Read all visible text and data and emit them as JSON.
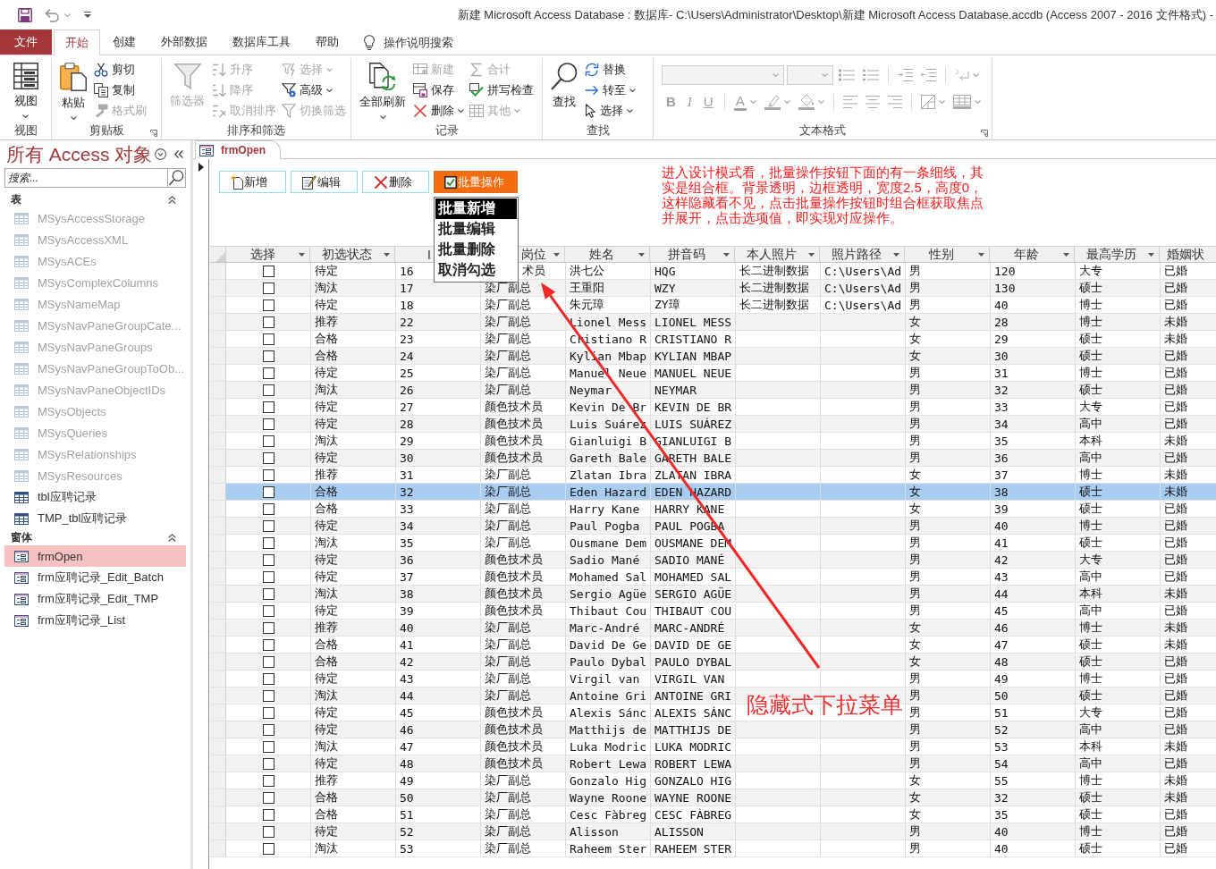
{
  "title_bar": {
    "title": "新建 Microsoft Access Database : 数据库- C:\\Users\\Administrator\\Desktop\\新建 Microsoft Access Database.accdb (Access 2007 - 2016 文件格式)  -"
  },
  "tabs": [
    {
      "label": "文件",
      "kind": "file",
      "selected": false
    },
    {
      "label": "开始",
      "kind": "tab",
      "selected": true
    },
    {
      "label": "创建",
      "kind": "tab",
      "selected": false
    },
    {
      "label": "外部数据",
      "kind": "tab",
      "selected": false
    },
    {
      "label": "数据库工具",
      "kind": "tab",
      "selected": false
    },
    {
      "label": "帮助",
      "kind": "tab",
      "selected": false
    }
  ],
  "tell_me": {
    "placeholder": "操作说明搜索"
  },
  "ribbon": {
    "groups": [
      {
        "label": "视图",
        "launcher": false,
        "items": [
          {
            "label": "视图",
            "kind": "large",
            "dropdown": true,
            "disabled": false
          }
        ]
      },
      {
        "label": "剪贴板",
        "launcher": true,
        "items": [
          {
            "label": "粘贴",
            "kind": "large",
            "dropdown": true,
            "disabled": false
          },
          {
            "label": "剪切",
            "kind": "small",
            "dropdown": false,
            "disabled": false
          },
          {
            "label": "复制",
            "kind": "small",
            "dropdown": false,
            "disabled": false
          },
          {
            "label": "格式刷",
            "kind": "small",
            "dropdown": false,
            "disabled": true
          }
        ]
      },
      {
        "label": "排序和筛选",
        "launcher": false,
        "items": [
          {
            "label": "筛选器",
            "kind": "large",
            "dropdown": false,
            "disabled": true
          },
          {
            "label": "升序",
            "kind": "small",
            "dropdown": false,
            "disabled": true
          },
          {
            "label": "降序",
            "kind": "small",
            "dropdown": false,
            "disabled": true
          },
          {
            "label": "取消排序",
            "kind": "small",
            "dropdown": false,
            "disabled": true
          },
          {
            "label": "选择",
            "kind": "small",
            "dropdown": true,
            "disabled": true
          },
          {
            "label": "高级",
            "kind": "small",
            "dropdown": true,
            "disabled": false
          },
          {
            "label": "切换筛选",
            "kind": "small",
            "dropdown": false,
            "disabled": true
          }
        ]
      },
      {
        "label": "记录",
        "launcher": false,
        "items": [
          {
            "label": "全部刷新",
            "kind": "large",
            "dropdown": true,
            "disabled": false
          },
          {
            "label": "新建",
            "kind": "small",
            "dropdown": false,
            "disabled": true
          },
          {
            "label": "保存",
            "kind": "small",
            "dropdown": false,
            "disabled": false
          },
          {
            "label": "删除",
            "kind": "small",
            "dropdown": true,
            "disabled": false
          },
          {
            "label": "合计",
            "kind": "small",
            "dropdown": false,
            "disabled": true
          },
          {
            "label": "拼写检查",
            "kind": "small",
            "dropdown": false,
            "disabled": false
          },
          {
            "label": "其他",
            "kind": "small",
            "dropdown": true,
            "disabled": true
          }
        ]
      },
      {
        "label": "查找",
        "launcher": false,
        "items": [
          {
            "label": "查找",
            "kind": "large",
            "dropdown": false,
            "disabled": false
          },
          {
            "label": "替换",
            "kind": "small",
            "dropdown": false,
            "disabled": false
          },
          {
            "label": "转至",
            "kind": "small",
            "dropdown": true,
            "disabled": false
          },
          {
            "label": "选择",
            "kind": "small",
            "dropdown": true,
            "disabled": false
          }
        ]
      },
      {
        "label": "文本格式",
        "launcher": true,
        "rows": [
          [
            {
              "kind": "combo",
              "disabled": true
            },
            {
              "kind": "combo",
              "disabled": true
            },
            {
              "kind": "icon",
              "dropdown": false,
              "disabled": true
            },
            {
              "kind": "icon",
              "dropdown": false,
              "disabled": true
            },
            {
              "kind": "separator"
            },
            {
              "kind": "icon",
              "dropdown": false,
              "disabled": true
            },
            {
              "kind": "icon",
              "dropdown": false,
              "disabled": true
            },
            {
              "kind": "separator"
            },
            {
              "kind": "icon",
              "dropdown": true,
              "disabled": true
            }
          ],
          [
            {
              "kind": "glyph",
              "label": "B",
              "dropdown": false,
              "disabled": true
            },
            {
              "kind": "glyph",
              "label": "I",
              "dropdown": false,
              "disabled": true
            },
            {
              "kind": "glyph",
              "label": "U",
              "dropdown": false,
              "disabled": true
            },
            {
              "kind": "separator"
            },
            {
              "kind": "glyph",
              "label": "A",
              "dropdown": true,
              "disabled": true
            },
            {
              "kind": "icon",
              "dropdown": true,
              "disabled": true
            },
            {
              "kind": "icon",
              "dropdown": true,
              "disabled": true
            },
            {
              "kind": "separator"
            },
            {
              "kind": "icon",
              "dropdown": false,
              "disabled": true
            },
            {
              "kind": "icon",
              "dropdown": false,
              "disabled": true
            },
            {
              "kind": "icon",
              "dropdown": false,
              "disabled": true
            },
            {
              "kind": "separator"
            },
            {
              "kind": "icon",
              "dropdown": true,
              "disabled": true
            },
            {
              "kind": "icon",
              "dropdown": true,
              "disabled": true
            }
          ]
        ]
      }
    ]
  },
  "nav_pane": {
    "title": "所有 Access 对象",
    "search": {
      "placeholder": "搜索..."
    },
    "groups": [
      {
        "label": "表",
        "expanded": true,
        "items": [
          {
            "label": "MSysAccessStorage",
            "kind": "table",
            "dimmed": true,
            "selected": false
          },
          {
            "label": "MSysAccessXML",
            "kind": "table",
            "dimmed": true,
            "selected": false
          },
          {
            "label": "MSysACEs",
            "kind": "table",
            "dimmed": true,
            "selected": false
          },
          {
            "label": "MSysComplexColumns",
            "kind": "table",
            "dimmed": true,
            "selected": false
          },
          {
            "label": "MSysNameMap",
            "kind": "table",
            "dimmed": true,
            "selected": false
          },
          {
            "label": "MSysNavPaneGroupCate...",
            "kind": "table",
            "dimmed": true,
            "selected": false
          },
          {
            "label": "MSysNavPaneGroups",
            "kind": "table",
            "dimmed": true,
            "selected": false
          },
          {
            "label": "MSysNavPaneGroupToOb...",
            "kind": "table",
            "dimmed": true,
            "selected": false
          },
          {
            "label": "MSysNavPaneObjectIDs",
            "kind": "table",
            "dimmed": true,
            "selected": false
          },
          {
            "label": "MSysObjects",
            "kind": "table",
            "dimmed": true,
            "selected": false
          },
          {
            "label": "MSysQueries",
            "kind": "table",
            "dimmed": true,
            "selected": false
          },
          {
            "label": "MSysRelationships",
            "kind": "table",
            "dimmed": true,
            "selected": false
          },
          {
            "label": "MSysResources",
            "kind": "table",
            "dimmed": true,
            "selected": false
          },
          {
            "label": "tbl应聘记录",
            "kind": "table",
            "dimmed": false,
            "selected": false
          },
          {
            "label": "TMP_tbl应聘记录",
            "kind": "table",
            "dimmed": false,
            "selected": false
          }
        ]
      },
      {
        "label": "窗体",
        "expanded": true,
        "items": [
          {
            "label": "frmOpen",
            "kind": "form",
            "dimmed": false,
            "selected": true
          },
          {
            "label": "frm应聘记录_Edit_Batch",
            "kind": "form",
            "dimmed": false,
            "selected": false
          },
          {
            "label": "frm应聘记录_Edit_TMP",
            "kind": "form",
            "dimmed": false,
            "selected": false
          },
          {
            "label": "frm应聘记录_List",
            "kind": "form",
            "dimmed": false,
            "selected": false
          }
        ]
      }
    ]
  },
  "document": {
    "tabs": [
      {
        "label": "frmOpen",
        "selected": true
      }
    ],
    "buttons": [
      {
        "label": "新增",
        "kind": "plain"
      },
      {
        "label": "编辑",
        "kind": "plain"
      },
      {
        "label": "删除",
        "kind": "plain"
      },
      {
        "label": "批量操作",
        "kind": "accent"
      }
    ],
    "dropdown": {
      "options": [
        {
          "label": "批量新增",
          "selected": true
        },
        {
          "label": "批量编辑",
          "selected": false
        },
        {
          "label": "批量删除",
          "selected": false
        },
        {
          "label": "取消勾选",
          "selected": false
        }
      ]
    },
    "note": "进入设计模式看，批量操作按钮下面的有一条细线，其实是组合框。背景透明，边框透明，宽度2.5，高度0，这样隐藏看不见，点击批量操作按钮时组合框获取焦点并展开，点击选项值，即实现对应操作。",
    "callout": "隐藏式下拉菜单",
    "datasheet": {
      "columns": [
        "选择",
        "初选状态",
        "I",
        "岗位",
        "姓名",
        "拼音码",
        "本人照片",
        "照片路径",
        "性别",
        "年龄",
        "最高学历",
        "婚姻状"
      ],
      "rows": [
        {
          "checked": false,
          "selected": false,
          "status": "待定",
          "column_3": "16",
          "column_4": "术员",
          "name": "洪七公",
          "pinyin": "HQG",
          "photo": "长二进制数据",
          "photo_path": "C:\\Users\\Ad",
          "gender": "男",
          "age": "120",
          "education": "大专",
          "column_12": "已婚"
        },
        {
          "checked": false,
          "selected": false,
          "status": "淘汰",
          "column_3": "17",
          "column_4": "染厂副总",
          "name": "王重阳",
          "pinyin": "WZY",
          "photo": "长二进制数据",
          "photo_path": "C:\\Users\\Ad",
          "gender": "男",
          "age": "130",
          "education": "硕士",
          "column_12": "已婚"
        },
        {
          "checked": false,
          "selected": false,
          "status": "待定",
          "column_3": "18",
          "column_4": "染厂副总",
          "name": "朱元璋",
          "pinyin": "ZY璋",
          "photo": "长二进制数据",
          "photo_path": "C:\\Users\\Ad",
          "gender": "男",
          "age": "40",
          "education": "博士",
          "column_12": "已婚"
        },
        {
          "checked": false,
          "selected": false,
          "status": "推荐",
          "column_3": "22",
          "column_4": "染厂副总",
          "name": "Lionel Mess",
          "pinyin": "LIONEL MESS",
          "gender": "女",
          "age": "28",
          "education": "博士",
          "column_12": "未婚"
        },
        {
          "checked": false,
          "selected": false,
          "status": "合格",
          "column_3": "23",
          "column_4": "染厂副总",
          "name": "Cristiano R",
          "pinyin": "CRISTIANO R",
          "gender": "女",
          "age": "29",
          "education": "硕士",
          "column_12": "未婚"
        },
        {
          "checked": false,
          "selected": false,
          "status": "合格",
          "column_3": "24",
          "column_4": "染厂副总",
          "name": "Kylian Mbap",
          "pinyin": "KYLIAN MBAP",
          "gender": "女",
          "age": "30",
          "education": "硕士",
          "column_12": "已婚"
        },
        {
          "checked": false,
          "selected": false,
          "status": "待定",
          "column_3": "25",
          "column_4": "染厂副总",
          "name": "Manuel Neue",
          "pinyin": "MANUEL NEUE",
          "gender": "男",
          "age": "31",
          "education": "博士",
          "column_12": "已婚"
        },
        {
          "checked": false,
          "selected": false,
          "status": "淘汰",
          "column_3": "26",
          "column_4": "染厂副总",
          "name": "Neymar",
          "pinyin": "NEYMAR",
          "gender": "男",
          "age": "32",
          "education": "硕士",
          "column_12": "已婚"
        },
        {
          "checked": false,
          "selected": false,
          "status": "待定",
          "column_3": "27",
          "column_4": "颜色技术员",
          "name": "Kevin De Br",
          "pinyin": "KEVIN DE BR",
          "gender": "男",
          "age": "33",
          "education": "大专",
          "column_12": "已婚"
        },
        {
          "checked": false,
          "selected": false,
          "status": "待定",
          "column_3": "28",
          "column_4": "颜色技术员",
          "name": "Luis Suárez",
          "pinyin": "LUIS SUÁREZ",
          "gender": "男",
          "age": "34",
          "education": "高中",
          "column_12": "已婚"
        },
        {
          "checked": false,
          "selected": false,
          "status": "淘汰",
          "column_3": "29",
          "column_4": "颜色技术员",
          "name": "Gianluigi B",
          "pinyin": "GIANLUIGI B",
          "gender": "男",
          "age": "35",
          "education": "本科",
          "column_12": "未婚"
        },
        {
          "checked": false,
          "selected": false,
          "status": "待定",
          "column_3": "30",
          "column_4": "颜色技术员",
          "name": "Gareth Bale",
          "pinyin": "GARETH BALE",
          "gender": "男",
          "age": "36",
          "education": "高中",
          "column_12": "已婚"
        },
        {
          "checked": false,
          "selected": false,
          "status": "推荐",
          "column_3": "31",
          "column_4": "染厂副总",
          "name": "Zlatan Ibra",
          "pinyin": "ZLATAN IBRA",
          "gender": "女",
          "age": "37",
          "education": "博士",
          "column_12": "未婚"
        },
        {
          "checked": false,
          "selected": true,
          "status": "合格",
          "column_3": "32",
          "column_4": "染厂副总",
          "name": "Eden Hazard",
          "pinyin": "EDEN HAZARD",
          "gender": "女",
          "age": "38",
          "education": "硕士",
          "column_12": "未婚"
        },
        {
          "checked": false,
          "selected": false,
          "status": "合格",
          "column_3": "33",
          "column_4": "染厂副总",
          "name": "Harry Kane",
          "pinyin": "HARRY KANE",
          "gender": "女",
          "age": "39",
          "education": "硕士",
          "column_12": "已婚"
        },
        {
          "checked": false,
          "selected": false,
          "status": "待定",
          "column_3": "34",
          "column_4": "染厂副总",
          "name": "Paul Pogba",
          "pinyin": "PAUL POGBA",
          "gender": "男",
          "age": "40",
          "education": "博士",
          "column_12": "已婚"
        },
        {
          "checked": false,
          "selected": false,
          "status": "淘汰",
          "column_3": "35",
          "column_4": "染厂副总",
          "name": "Ousmane Dem",
          "pinyin": "OUSMANE DEM",
          "gender": "男",
          "age": "41",
          "education": "硕士",
          "column_12": "已婚"
        },
        {
          "checked": false,
          "selected": false,
          "status": "待定",
          "column_3": "36",
          "column_4": "颜色技术员",
          "name": "Sadio Mané",
          "pinyin": "SADIO MANÉ",
          "gender": "男",
          "age": "42",
          "education": "大专",
          "column_12": "已婚"
        },
        {
          "checked": false,
          "selected": false,
          "status": "待定",
          "column_3": "37",
          "column_4": "颜色技术员",
          "name": "Mohamed Sal",
          "pinyin": "MOHAMED SAL",
          "gender": "男",
          "age": "43",
          "education": "高中",
          "column_12": "已婚"
        },
        {
          "checked": false,
          "selected": false,
          "status": "淘汰",
          "column_3": "38",
          "column_4": "颜色技术员",
          "name": "Sergio Agüe",
          "pinyin": "SERGIO AGÜE",
          "gender": "男",
          "age": "44",
          "education": "本科",
          "column_12": "未婚"
        },
        {
          "checked": false,
          "selected": false,
          "status": "待定",
          "column_3": "39",
          "column_4": "颜色技术员",
          "name": "Thibaut Cou",
          "pinyin": "THIBAUT COU",
          "gender": "男",
          "age": "45",
          "education": "高中",
          "column_12": "已婚"
        },
        {
          "checked": false,
          "selected": false,
          "status": "推荐",
          "column_3": "40",
          "column_4": "染厂副总",
          "name": "Marc-André",
          "pinyin": "MARC-ANDRÉ",
          "gender": "女",
          "age": "46",
          "education": "博士",
          "column_12": "未婚"
        },
        {
          "checked": false,
          "selected": false,
          "status": "合格",
          "column_3": "41",
          "column_4": "染厂副总",
          "name": "David De Ge",
          "pinyin": "DAVID DE GE",
          "gender": "女",
          "age": "47",
          "education": "硕士",
          "column_12": "未婚"
        },
        {
          "checked": false,
          "selected": false,
          "status": "合格",
          "column_3": "42",
          "column_4": "染厂副总",
          "name": "Paulo Dybal",
          "pinyin": "PAULO DYBAL",
          "gender": "女",
          "age": "48",
          "education": "硕士",
          "column_12": "已婚"
        },
        {
          "checked": false,
          "selected": false,
          "status": "待定",
          "column_3": "43",
          "column_4": "染厂副总",
          "name": "Virgil van",
          "pinyin": "VIRGIL VAN",
          "gender": "男",
          "age": "49",
          "education": "博士",
          "column_12": "已婚"
        },
        {
          "checked": false,
          "selected": false,
          "status": "淘汰",
          "column_3": "44",
          "column_4": "染厂副总",
          "name": "Antoine Gri",
          "pinyin": "ANTOINE GRI",
          "gender": "男",
          "age": "50",
          "education": "硕士",
          "column_12": "已婚"
        },
        {
          "checked": false,
          "selected": false,
          "status": "待定",
          "column_3": "45",
          "column_4": "颜色技术员",
          "name": "Alexis Sánc",
          "pinyin": "ALEXIS SÁNC",
          "gender": "男",
          "age": "51",
          "education": "大专",
          "column_12": "已婚"
        },
        {
          "checked": false,
          "selected": false,
          "status": "待定",
          "column_3": "46",
          "column_4": "颜色技术员",
          "name": "Matthijs de",
          "pinyin": "MATTHIJS DE",
          "gender": "男",
          "age": "52",
          "education": "高中",
          "column_12": "已婚"
        },
        {
          "checked": false,
          "selected": false,
          "status": "淘汰",
          "column_3": "47",
          "column_4": "颜色技术员",
          "name": "Luka Modric",
          "pinyin": "LUKA MODRIC",
          "gender": "男",
          "age": "53",
          "education": "本科",
          "column_12": "未婚"
        },
        {
          "checked": false,
          "selected": false,
          "status": "待定",
          "column_3": "48",
          "column_4": "颜色技术员",
          "name": "Robert Lewa",
          "pinyin": "ROBERT LEWA",
          "gender": "男",
          "age": "54",
          "education": "高中",
          "column_12": "已婚"
        },
        {
          "checked": false,
          "selected": false,
          "status": "推荐",
          "column_3": "49",
          "column_4": "染厂副总",
          "name": "Gonzalo Hig",
          "pinyin": "GONZALO HIG",
          "gender": "女",
          "age": "55",
          "education": "博士",
          "column_12": "未婚"
        },
        {
          "checked": false,
          "selected": false,
          "status": "合格",
          "column_3": "50",
          "column_4": "染厂副总",
          "name": "Wayne Roone",
          "pinyin": "WAYNE ROONE",
          "gender": "女",
          "age": "32",
          "education": "硕士",
          "column_12": "未婚"
        },
        {
          "checked": false,
          "selected": false,
          "status": "合格",
          "column_3": "51",
          "column_4": "染厂副总",
          "name": "Cesc Fàbreg",
          "pinyin": "CESC FÀBREG",
          "gender": "女",
          "age": "35",
          "education": "硕士",
          "column_12": "已婚"
        },
        {
          "checked": false,
          "selected": false,
          "status": "待定",
          "column_3": "52",
          "column_4": "染厂副总",
          "name": "Alisson",
          "pinyin": "ALISSON",
          "gender": "男",
          "age": "40",
          "education": "博士",
          "column_12": "已婚"
        },
        {
          "checked": false,
          "selected": false,
          "status": "淘汰",
          "column_3": "53",
          "column_4": "染厂副总",
          "name": "Raheem Ster",
          "pinyin": "RAHEEM STER",
          "gender": "男",
          "age": "40",
          "education": "硕士",
          "column_12": "已婚"
        }
      ]
    }
  }
}
